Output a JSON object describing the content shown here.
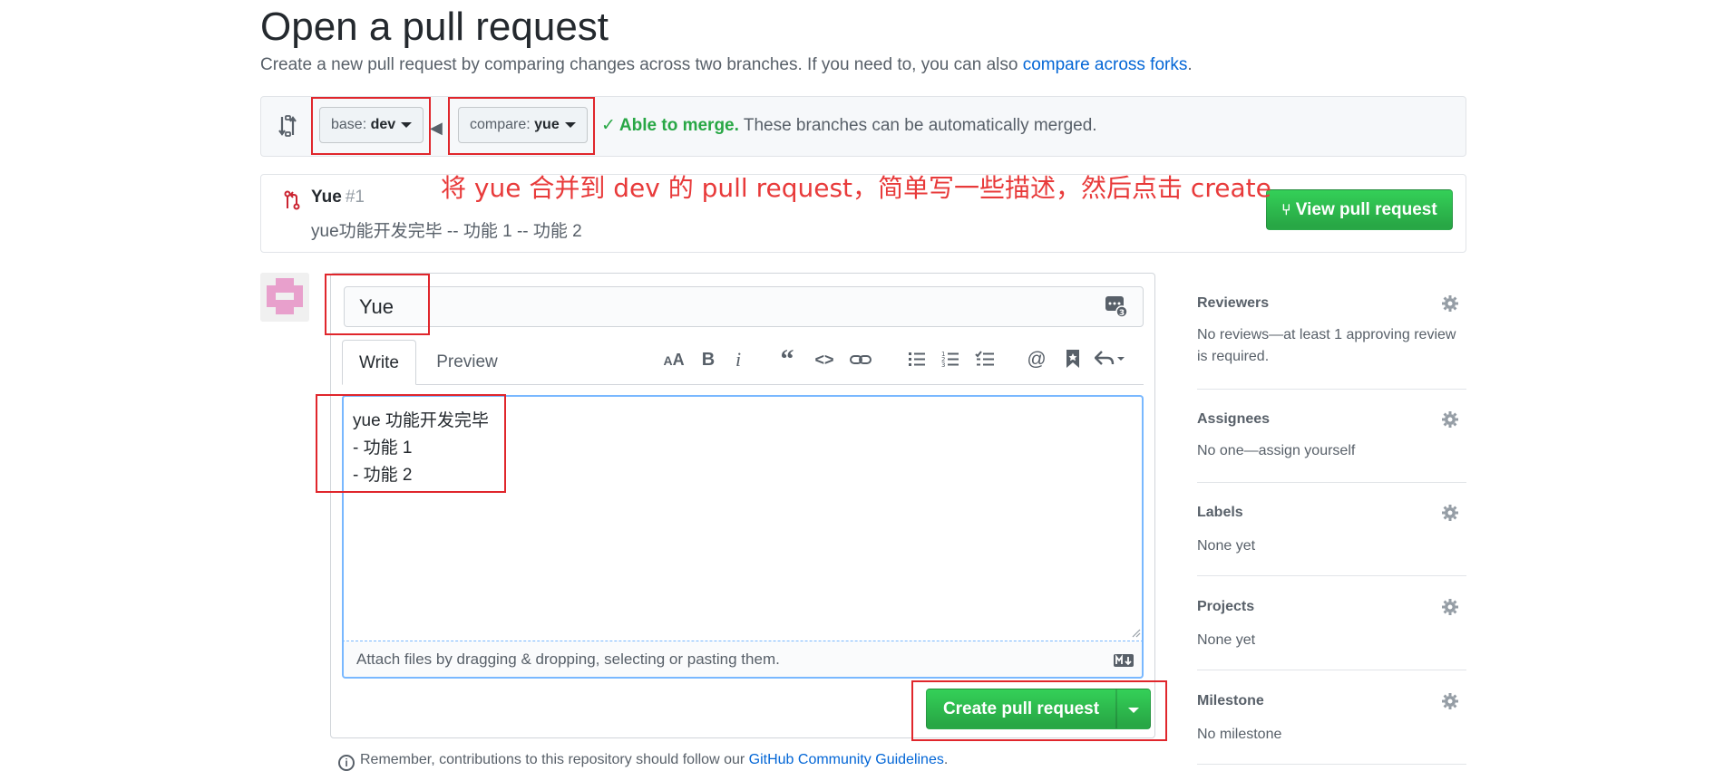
{
  "header": {
    "title": "Open a pull request",
    "subtitle_text": "Create a new pull request by comparing changes across two branches. If you need to, you can also",
    "subtitle_link": "compare across forks",
    "subtitle_end": "."
  },
  "compare": {
    "base_label": "base:",
    "base_value": "dev",
    "compare_label": "compare:",
    "compare_value": "yue",
    "merge_status": "Able to merge.",
    "merge_message": "These branches can be automatically merged."
  },
  "annotation": "将 yue 合并到 dev 的 pull request，简单写一些描述，然后点击 create",
  "existing_pr": {
    "name": "Yue",
    "number": "#1",
    "description": "yue功能开发完毕 -- 功能 1 -- 功能 2",
    "view_button": "View pull request"
  },
  "form": {
    "title_value": "Yue",
    "tabs": {
      "write": "Write",
      "preview": "Preview"
    },
    "toolbar": [
      "AA",
      "B",
      "i",
      "“",
      "<>",
      "link",
      "ul",
      "ol",
      "task",
      "@",
      "bookmark",
      "reply"
    ],
    "body": "yue 功能开发完毕\n- 功能 1\n- 功能 2",
    "attach_text": "Attach files by dragging & dropping, selecting or pasting them.",
    "submit_button": "Create pull request"
  },
  "footer": {
    "remember_text": "Remember, contributions to this repository should follow our",
    "guidelines_link": "GitHub Community Guidelines",
    "end": "."
  },
  "sidebar": {
    "reviewers": {
      "title": "Reviewers",
      "text": "No reviews—at least 1 approving review",
      "text2": "is required."
    },
    "assignees": {
      "title": "Assignees",
      "text": "No one—assign yourself"
    },
    "labels": {
      "title": "Labels",
      "text": "None yet"
    },
    "projects": {
      "title": "Projects",
      "text": "None yet"
    },
    "milestone": {
      "title": "Milestone",
      "text": "No milestone"
    }
  },
  "colors": {
    "accent_green": "#28a745",
    "link_blue": "#0366d6",
    "annotation_red": "#e83a3a"
  }
}
